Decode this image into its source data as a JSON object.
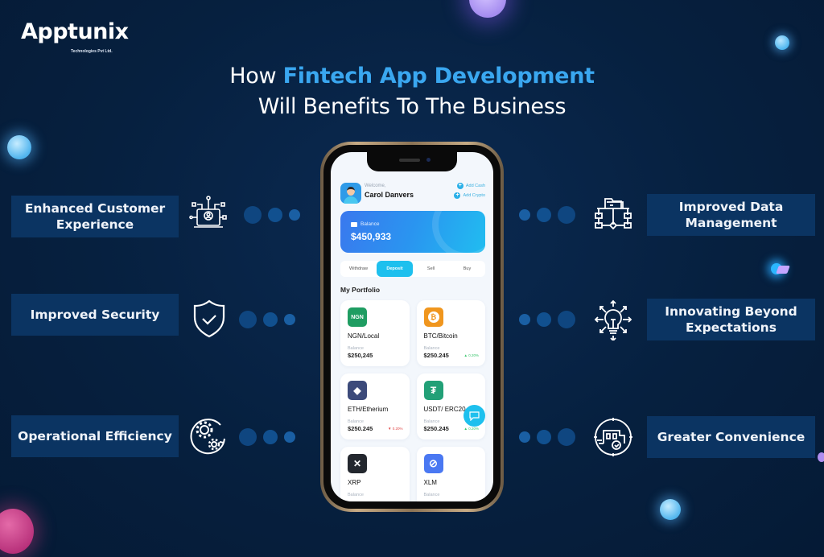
{
  "brand": {
    "name": "Apptunix",
    "tagline": "Technologies Pvt Ltd."
  },
  "headline": {
    "prefix": "How ",
    "highlight": "Fintech App Development",
    "line2": "Will Benefits To The Business",
    "highlight_color": "#3aa7f0"
  },
  "features_left": [
    {
      "label": "Enhanced Customer Experience",
      "icon": "laptop-user-network-icon"
    },
    {
      "label": "Improved Security",
      "icon": "shield-check-icon"
    },
    {
      "label": "Operational Efficiency",
      "icon": "gears-cycle-icon"
    }
  ],
  "features_right": [
    {
      "label": "Improved Data Management",
      "icon": "folder-network-icon"
    },
    {
      "label": "Innovating Beyond Expectations",
      "icon": "lightbulb-arrows-icon"
    },
    {
      "label": "Greater Convenience",
      "icon": "delivery-truck-check-icon"
    }
  ],
  "phone": {
    "welcome_label": "Welcome,",
    "user_name": "Carol Danvers",
    "quick_actions": [
      "Add Cash",
      "Add Crypto"
    ],
    "balance_label": "Balance",
    "balance_value": "$450,933",
    "action_tabs": [
      {
        "label": "Withdraw",
        "active": false
      },
      {
        "label": "Deposit",
        "active": true
      },
      {
        "label": "Sell",
        "active": false
      },
      {
        "label": "Buy",
        "active": false
      }
    ],
    "portfolio_title": "My Portfolio",
    "coins": [
      {
        "name": "NGN/Local",
        "icon_text": "NGN",
        "icon": "ngn-icon",
        "color": "#1f9d62",
        "balance_label": "Balance",
        "balance": "$250,245",
        "change": "",
        "direction": ""
      },
      {
        "name": "BTC/Bitcoin",
        "icon_text": "₿",
        "icon": "bitcoin-icon",
        "color": "#f0961e",
        "balance_label": "Balance",
        "balance": "$250.245",
        "change": "▲ 0.20%",
        "direction": "up"
      },
      {
        "name": "ETH/Etherium",
        "icon_text": "◆",
        "icon": "ethereum-icon",
        "color": "#3c4a7a",
        "balance_label": "Balance",
        "balance": "$250.245",
        "change": "▼ 0.20%",
        "direction": "down"
      },
      {
        "name": "USDT/ ERC20",
        "icon_text": "₮",
        "icon": "tether-icon",
        "color": "#22a077",
        "balance_label": "Balance",
        "balance": "$250.245",
        "change": "▲ 0.20%",
        "direction": "up"
      },
      {
        "name": "XRP",
        "icon_text": "✕",
        "icon": "xrp-icon",
        "color": "#23272e",
        "balance_label": "Balance",
        "balance": "",
        "change": "",
        "direction": ""
      },
      {
        "name": "XLM",
        "icon_text": "⊘",
        "icon": "stellar-icon",
        "color": "#4a78f2",
        "balance_label": "Balance",
        "balance": "",
        "change": "",
        "direction": ""
      }
    ]
  }
}
